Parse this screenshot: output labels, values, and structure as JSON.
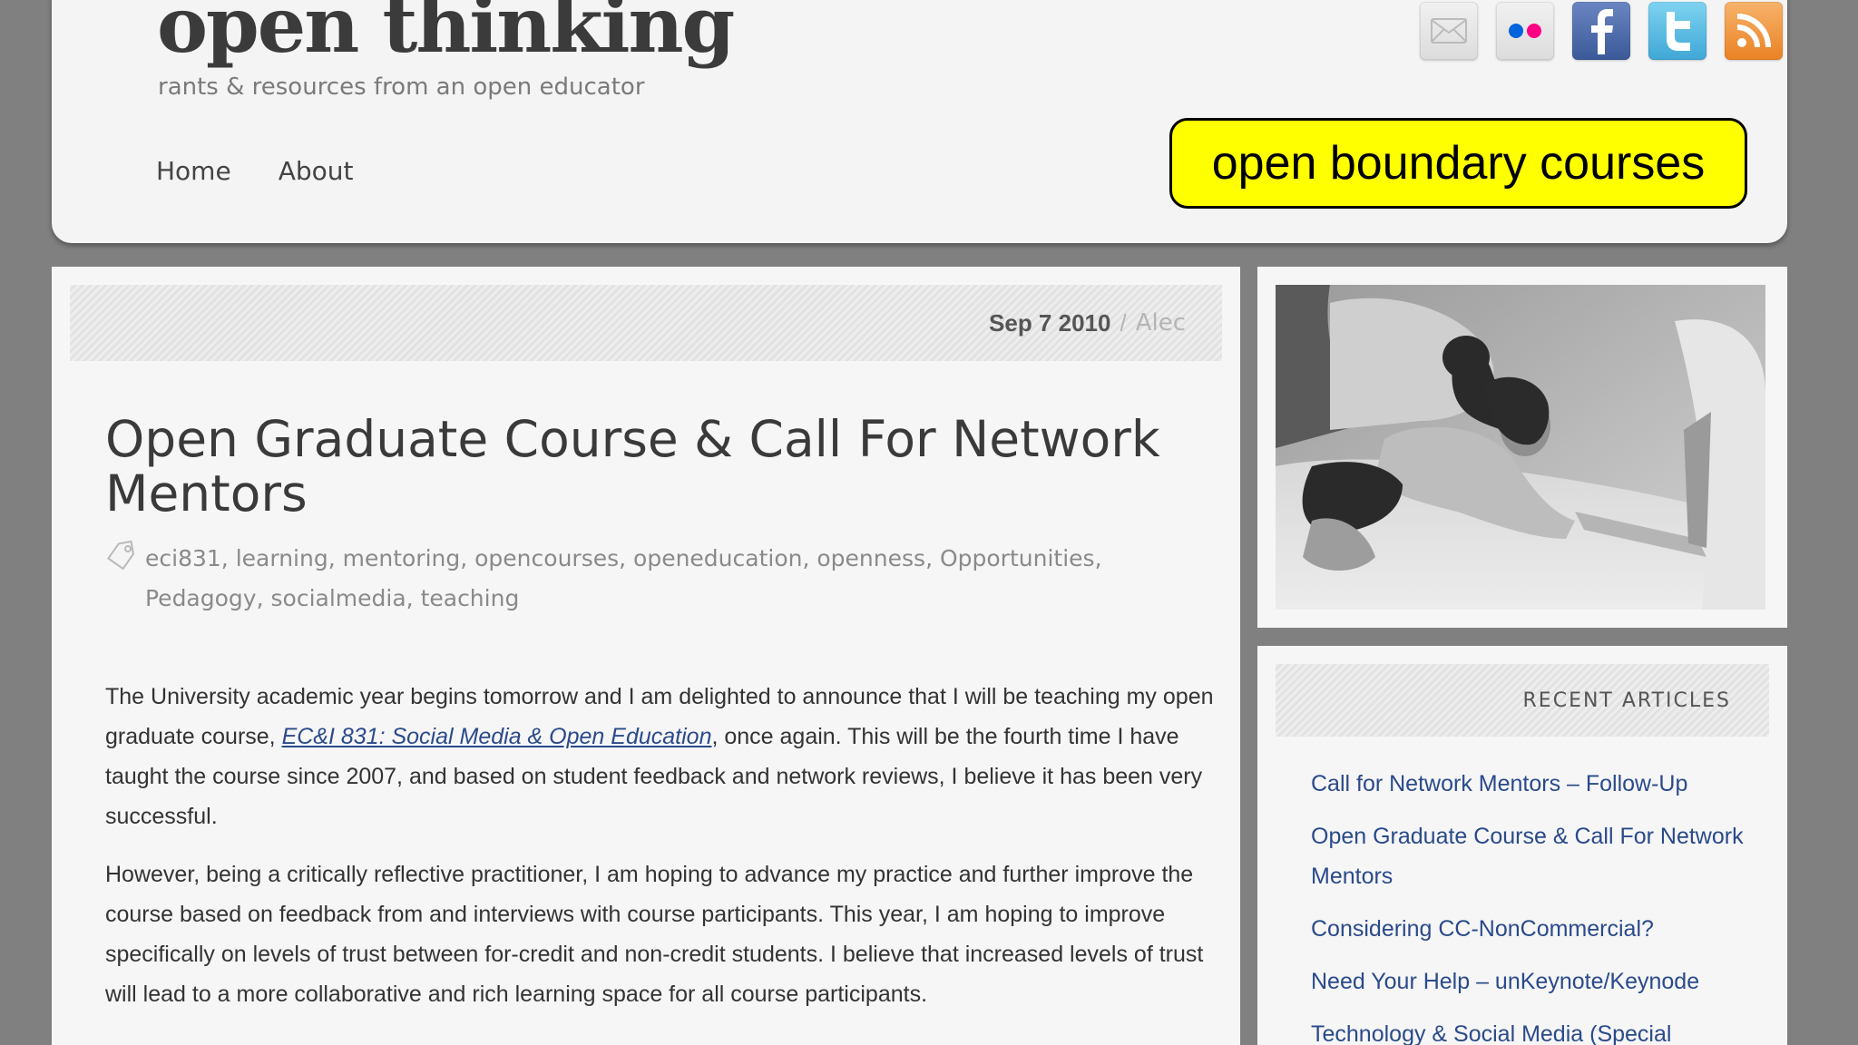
{
  "site": {
    "title": "open thinking",
    "tagline": "rants & resources from an open educator"
  },
  "nav": {
    "items": [
      {
        "label": "Home"
      },
      {
        "label": "About"
      }
    ]
  },
  "social": {
    "icons": [
      "mail-icon",
      "flickr-icon",
      "facebook-icon",
      "twitter-icon",
      "rss-icon"
    ],
    "colors": {
      "facebook": "#3b5998",
      "twitter": "#3fa7d6",
      "rss": "#ea8224",
      "flickr_blue": "#0063dc",
      "flickr_pink": "#ff0084"
    }
  },
  "callout": {
    "text": "open boundary courses",
    "color": "#ffff00"
  },
  "post": {
    "date": "Sep 7 2010",
    "separator": "/",
    "author": "Alec",
    "title": "Open Graduate Course & Call For Network Mentors",
    "tags": [
      "eci831",
      "learning",
      "mentoring",
      "opencourses",
      "openeducation",
      "openness",
      "Opportunities",
      "Pedagogy",
      "socialmedia",
      "teaching"
    ],
    "p1_before": "The University academic year begins tomorrow and I am delighted to announce that I will be teaching my open graduate course, ",
    "p1_link": "EC&I 831: Social Media & Open Education",
    "p1_after": ", once again. This will be the fourth time I have taught the course since 2007, and based on student feedback and network reviews, I believe it has been very successful.",
    "p2": "However, being a critically reflective practitioner, I am hoping to advance my practice and further improve the course based on feedback from and interviews with course participants. This year, I am hoping to improve specifically on levels of trust between for-credit and non-credit students. I believe that increased levels of trust will lead to a more collaborative and rich learning space for all course participants."
  },
  "sidebar": {
    "recent_heading": "RECENT ARTICLES",
    "recent": [
      "Call for Network Mentors – Follow-Up",
      "Open Graduate Course & Call For Network Mentors",
      "Considering CC-NonCommercial?",
      "Need Your Help – unKeynote/Keynode",
      "Technology & Social Media (Special"
    ]
  }
}
